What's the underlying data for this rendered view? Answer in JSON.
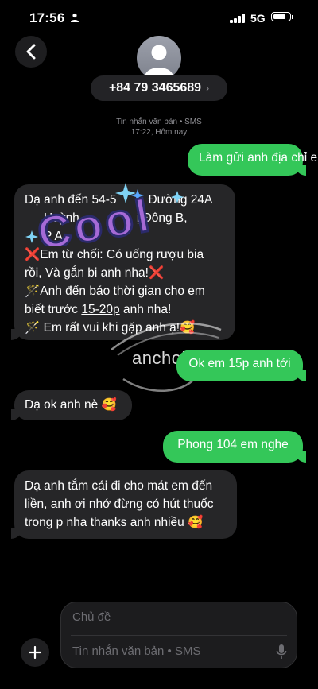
{
  "status_bar": {
    "time": "17:56",
    "network": "5G",
    "battery_level": 0.85
  },
  "header": {
    "contact_number": "+84 79 3465689",
    "chevron": "›"
  },
  "thread_meta": {
    "service": "Tin nhắn văn bản • SMS",
    "timestamp": "17:22, Hôm nay"
  },
  "messages": [
    {
      "direction": "outgoing",
      "lines": [
        "Làm gửi anh địa chỉ em"
      ]
    },
    {
      "direction": "incoming",
      "lines": [
        "Dạ anh đến 54-5",
        "Đường 24A",
        "Huỳnh",
        "ị Đông B,",
        "P A",
        "❌Em từ chối: Có uống rượu bia",
        "rồi, Và gắn bi anh nha!❌",
        "🪄Anh đến báo thời gian cho em",
        "biết trước ",
        "15-20p",
        " anh nha!",
        "🪄 Em rất vui khi gặp anh ạ!🥰"
      ]
    },
    {
      "direction": "outgoing",
      "lines": [
        "Ok em 15p anh tới"
      ]
    },
    {
      "direction": "incoming",
      "lines": [
        "Dạ ok anh nè 🥰"
      ]
    },
    {
      "direction": "outgoing",
      "lines": [
        "Phong 104 em nghe"
      ]
    },
    {
      "direction": "incoming",
      "lines": [
        "Dạ anh tắm cái đi cho mát em đến",
        "liền, anh ơi nhớ đừng có hút thuốc",
        "trong p nha thanks anh nhiều 🥰"
      ]
    }
  ],
  "overlays": {
    "sticker_text": "Cool",
    "watermark_text": "anchoi.ac"
  },
  "composer": {
    "subject_placeholder": "Chủ đề",
    "message_placeholder": "Tin nhắn văn bản • SMS"
  },
  "colors": {
    "outgoing_bubble": "#34c759",
    "incoming_bubble": "#262628",
    "background": "#000000",
    "sticker_fill": "#a56ad6",
    "sticker_outline": "#2b2a6b"
  },
  "icons": {
    "back": "chevron-left-icon",
    "avatar": "person-icon",
    "plus": "plus-icon",
    "mic": "mic-icon"
  }
}
